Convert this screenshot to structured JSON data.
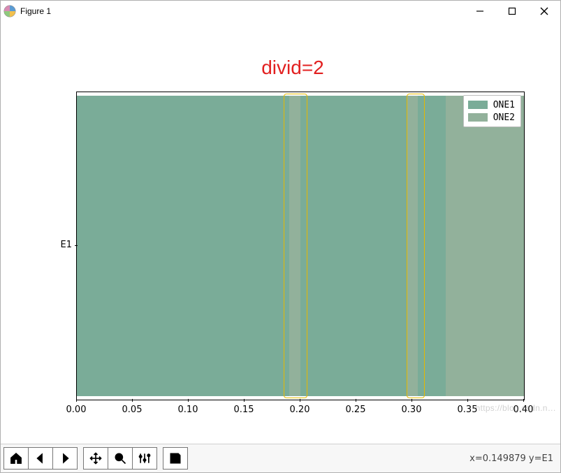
{
  "window": {
    "title": "Figure 1"
  },
  "chart_data": {
    "type": "bar",
    "orientation": "horizontal",
    "stacked": true,
    "title": "divid=2",
    "title_color": "#e22020",
    "ylabel": "",
    "xlabel": "",
    "y_categories": [
      "E1"
    ],
    "xlim": [
      0.0,
      0.4
    ],
    "xticks": [
      0.0,
      0.05,
      0.1,
      0.15,
      0.2,
      0.25,
      0.3,
      0.35,
      0.4
    ],
    "xtick_labels": [
      "0.00",
      "0.05",
      "0.10",
      "0.15",
      "0.20",
      "0.25",
      "0.30",
      "0.35",
      "0.40"
    ],
    "series": [
      {
        "name": "ONE1",
        "color": "#7aac98",
        "values": [
          0.19
        ]
      },
      {
        "name": "ONE2",
        "color": "#92b19b",
        "values": [
          0.01
        ]
      },
      {
        "name": "ONE1",
        "color": "#7aac98",
        "values": [
          0.095
        ]
      },
      {
        "name": "ONE2",
        "color": "#92b19b",
        "values": [
          0.01
        ]
      },
      {
        "name": "ONE1",
        "color": "#7aac98",
        "values": [
          0.025
        ]
      },
      {
        "name": "ONE2",
        "color": "#92b19b",
        "values": [
          0.07
        ]
      }
    ],
    "highlights": [
      {
        "x0": 0.185,
        "x1": 0.205,
        "color": "#e6b800"
      },
      {
        "x0": 0.295,
        "x1": 0.31,
        "color": "#e6b800"
      }
    ],
    "legend": {
      "position": "upper right",
      "entries": [
        {
          "label": "ONE1",
          "color": "#7aac98"
        },
        {
          "label": "ONE2",
          "color": "#92b19b"
        }
      ]
    }
  },
  "status": {
    "coord_text": "x=0.149879    y=E1"
  },
  "watermark": "https://blog.csdn.n…"
}
